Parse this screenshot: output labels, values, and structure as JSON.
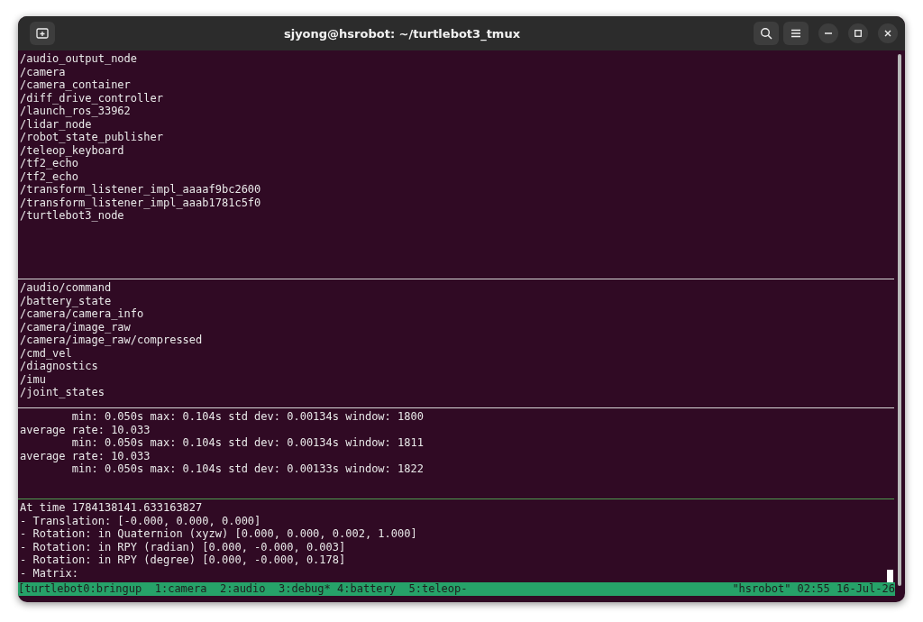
{
  "window": {
    "title": "sjyong@hsrobot: ~/turtlebot3_tmux"
  },
  "panes": [
    {
      "active": false,
      "lines": [
        "/audio_output_node",
        "/camera",
        "/camera_container",
        "/diff_drive_controller",
        "/launch_ros_33962",
        "/lidar_node",
        "/robot_state_publisher",
        "/teleop_keyboard",
        "/tf2_echo",
        "/tf2_echo",
        "/transform_listener_impl_aaaaf9bc2600",
        "/transform_listener_impl_aaab1781c5f0",
        "/turtlebot3_node"
      ]
    },
    {
      "active": false,
      "lines": [
        "/audio/command",
        "/battery_state",
        "/camera/camera_info",
        "/camera/image_raw",
        "/camera/image_raw/compressed",
        "/cmd_vel",
        "/diagnostics",
        "/imu",
        "/joint_states"
      ]
    },
    {
      "active": false,
      "lines": [
        "        min: 0.050s max: 0.104s std dev: 0.00134s window: 1800",
        "average rate: 10.033",
        "        min: 0.050s max: 0.104s std dev: 0.00134s window: 1811",
        "average rate: 10.033",
        "        min: 0.050s max: 0.104s std dev: 0.00133s window: 1822"
      ]
    },
    {
      "active": true,
      "lines": [
        "At time 1784138141.633163827",
        "- Translation: [-0.000, 0.000, 0.000]",
        "- Rotation: in Quaternion (xyzw) [0.000, 0.000, 0.002, 1.000]",
        "- Rotation: in RPY (radian) [0.000, -0.000, 0.003]",
        "- Rotation: in RPY (degree) [0.000, -0.000, 0.178]",
        "- Matrix:"
      ]
    }
  ],
  "status_bar": {
    "left": "[turtlebot0:bringup  1:camera  2:audio  3:debug* 4:battery  5:teleop-",
    "right": "\"hsrobot\" 02:55 16-Jul-26"
  }
}
